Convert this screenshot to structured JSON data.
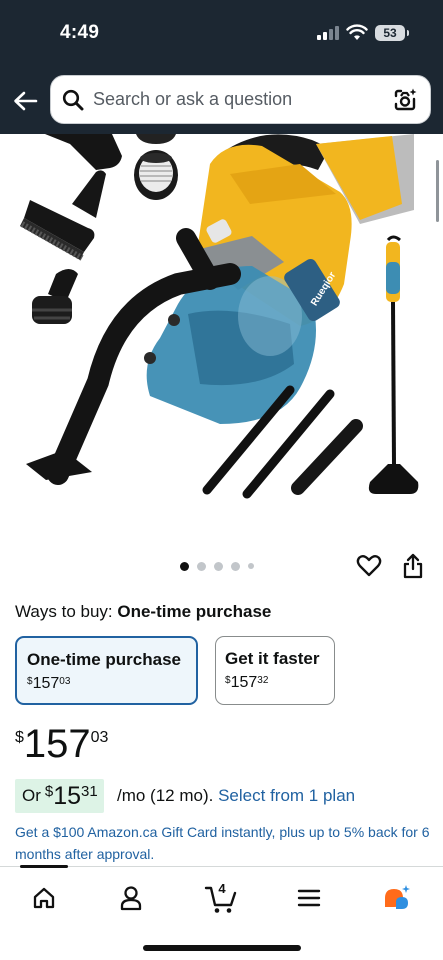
{
  "status_bar": {
    "time": "4:49",
    "battery": "53"
  },
  "search": {
    "placeholder": "Search or ask a question"
  },
  "product": {
    "brand_on_image": "Rueqior"
  },
  "ways_to_buy": {
    "label": "Ways to buy:",
    "value": "One-time purchase"
  },
  "options": [
    {
      "title": "One-time purchase",
      "currency": "$",
      "whole": "157",
      "fraction": "03",
      "selected": true
    },
    {
      "title": "Get it faster",
      "currency": "$",
      "whole": "157",
      "fraction": "32",
      "selected": false
    }
  ],
  "price": {
    "currency": "$",
    "whole": "157",
    "fraction": "03"
  },
  "installment": {
    "prefix": "Or",
    "currency": "$",
    "whole": "15",
    "fraction": "31",
    "term": "/mo (12 mo).",
    "link": "Select from 1 plan"
  },
  "promo": {
    "text": "Get a $100 Amazon.ca Gift Card instantly, plus up to 5% back for 6 months after approval."
  },
  "bottom_nav": {
    "cart_count": "4"
  },
  "colors": {
    "header_bg": "#1c2732",
    "link": "#2162a1",
    "selected_border": "#2162a1",
    "installment_bg": "#ddf3e6",
    "vacuum_yellow": "#f2b61f"
  }
}
